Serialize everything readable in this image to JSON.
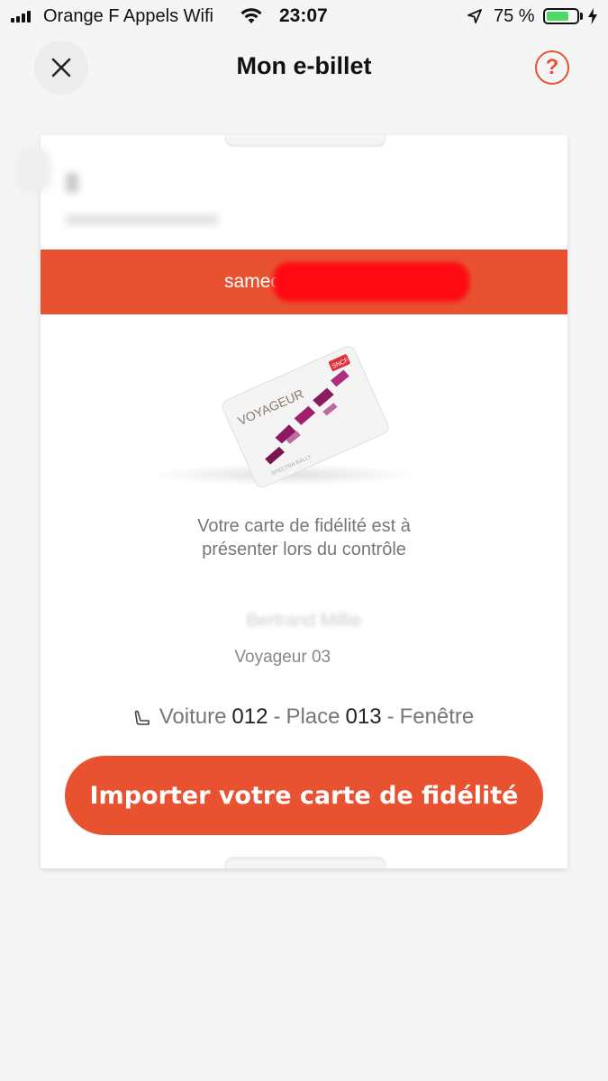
{
  "status_bar": {
    "carrier": "Orange F Appels Wifi",
    "time": "23:07",
    "battery_percent": "75 %",
    "battery_level": 0.75
  },
  "header": {
    "title": "Mon e-billet",
    "close_icon": "close-icon",
    "help_label": "?"
  },
  "ticket": {
    "date": "samedi 20",
    "card_brand": "SNCF",
    "card_name": "VOYAGEUR",
    "card_sub": "SPECTRA BALLY",
    "info_line1": "Votre carte de fidélité est à",
    "info_line2": "présenter lors du contrôle",
    "traveler_name": "Bertrand Millie",
    "traveler_card": "Voyageur 03",
    "seat": {
      "car_label": "Voiture",
      "car_number": "012",
      "sep1": "-",
      "place_label": "Place",
      "place_number": "013",
      "sep2": "-",
      "position": "Fenêtre"
    },
    "import_button": "Importer votre carte de fidélité"
  },
  "colors": {
    "accent": "#e85230",
    "redaction": "#ff0a12"
  }
}
